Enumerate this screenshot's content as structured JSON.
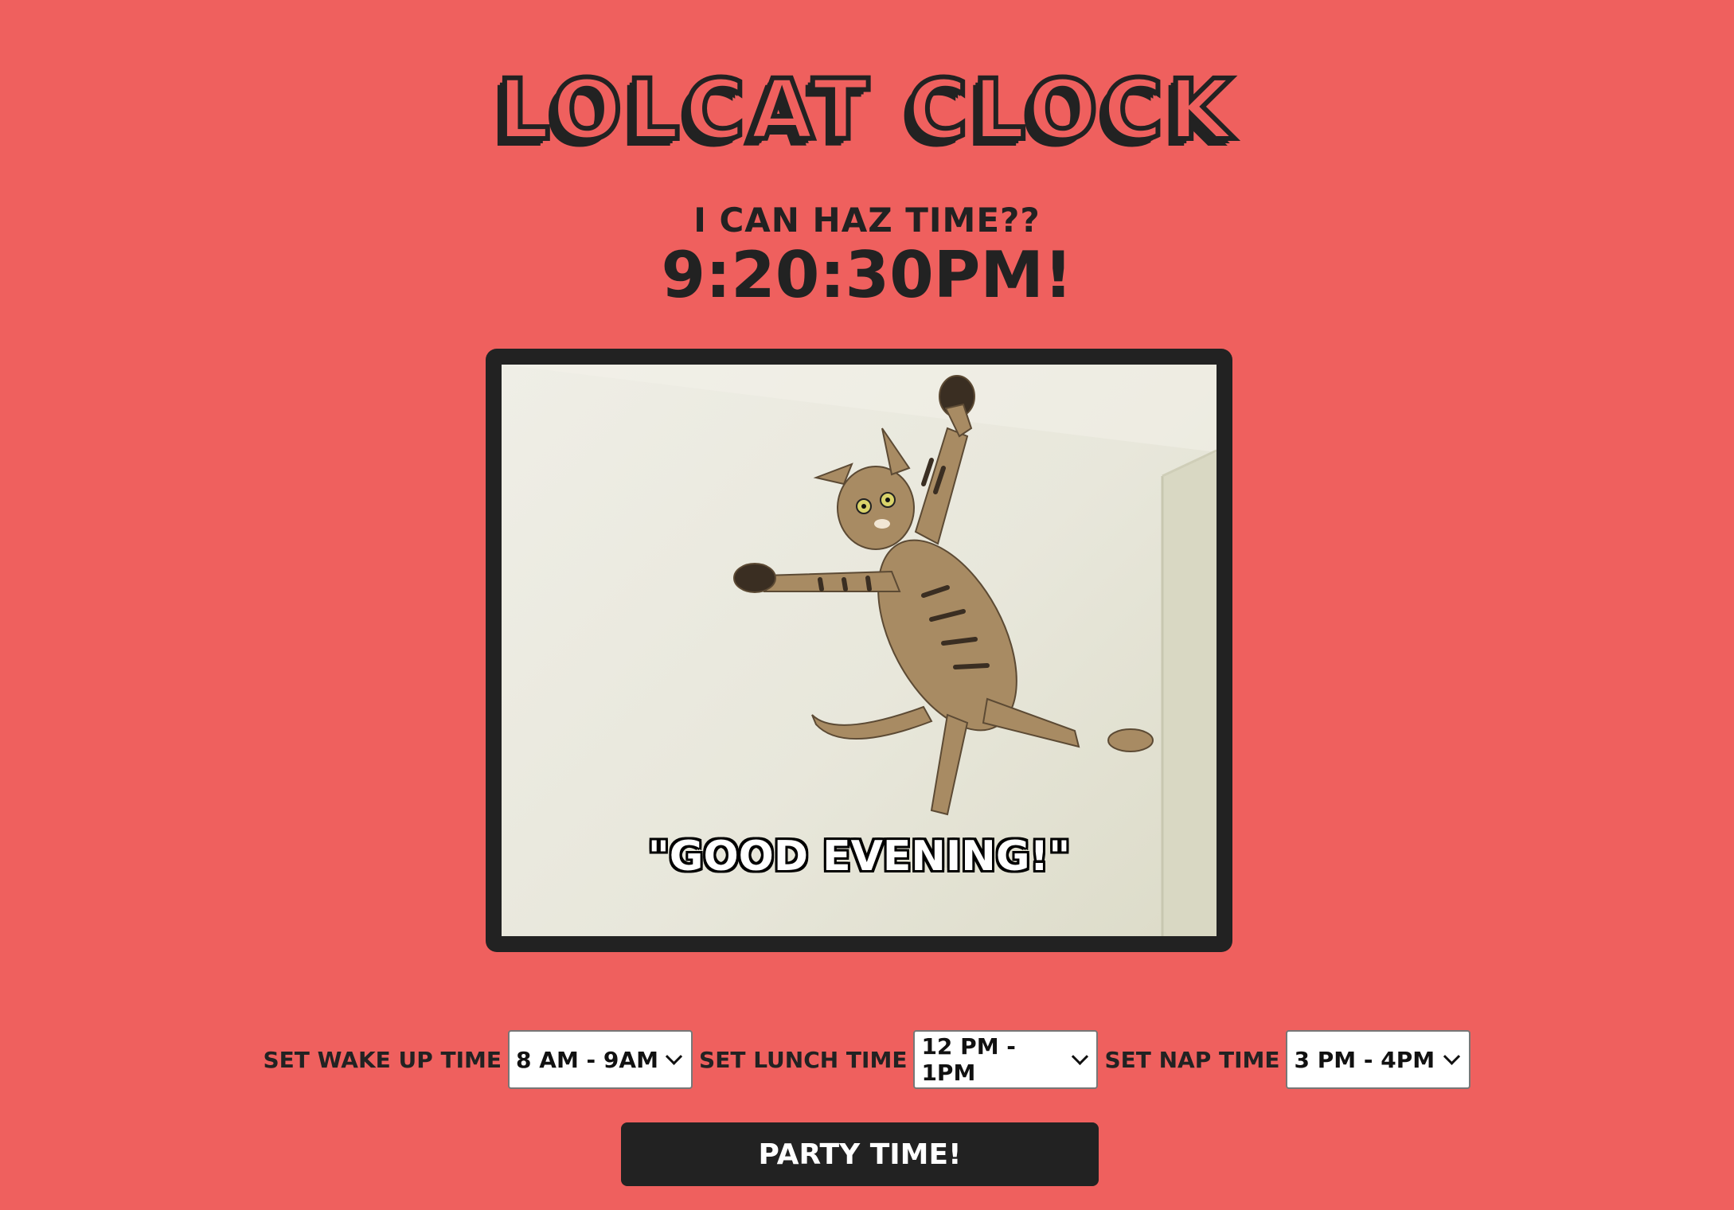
{
  "header": {
    "title": "Lolcat Clock",
    "subtitle": "I can haz time??",
    "time": "9:20:30PM!"
  },
  "photo": {
    "caption": "\"GOOD EVENING!\""
  },
  "controls": {
    "wake": {
      "label": "Set Wake Up Time",
      "value": "8 AM - 9AM"
    },
    "lunch": {
      "label": "Set Lunch Time",
      "value": "12 PM - 1PM"
    },
    "nap": {
      "label": "Set Nap Time",
      "value": "3 PM - 4PM"
    }
  },
  "party_button": {
    "label": "Party Time!"
  },
  "colors": {
    "background": "#ef605e",
    "dark": "#222222",
    "white": "#ffffff"
  }
}
